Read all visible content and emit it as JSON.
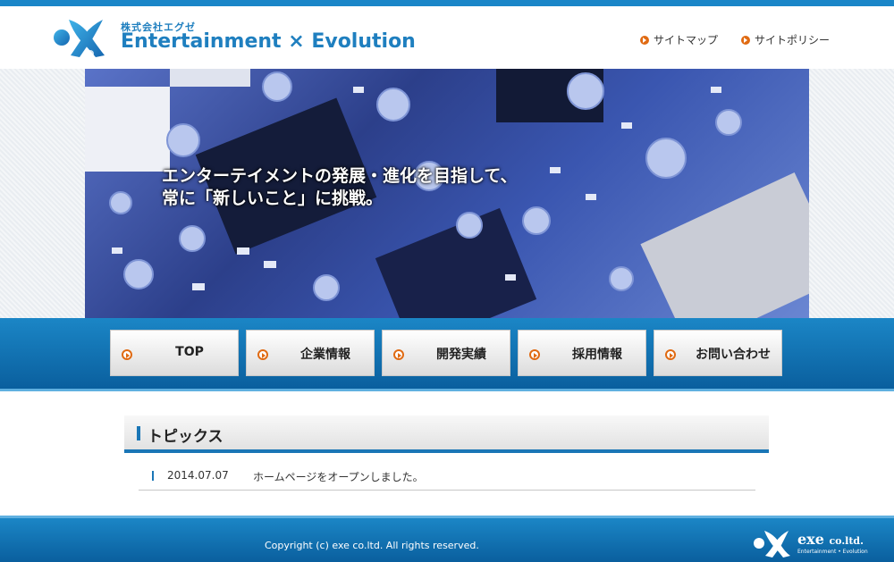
{
  "brand": {
    "company_ja": "株式会社エグゼ",
    "tagline": "Entertainment × Evolution",
    "accent": "#1f7fbf",
    "logo_icon": "exe-x-logo-icon"
  },
  "header_links": [
    {
      "label": "サイトマップ",
      "icon": "orange-arrow-icon"
    },
    {
      "label": "サイトポリシー",
      "icon": "orange-arrow-icon"
    }
  ],
  "hero": {
    "line1": "エンターテイメントの発展・進化を目指して、",
    "line2": "常に「新しいこと」に挑戦。",
    "image": "circuit-board-photo"
  },
  "nav": [
    {
      "label": "TOP"
    },
    {
      "label": "企業情報"
    },
    {
      "label": "開発実績"
    },
    {
      "label": "採用情報"
    },
    {
      "label": "お問い合わせ"
    }
  ],
  "topics": {
    "title": "トピックス",
    "items": [
      {
        "date": "2014.07.07",
        "text": "ホームページをオープンしました。"
      }
    ]
  },
  "footer": {
    "copyright": "Copyright (c) exe co.ltd. All rights reserved.",
    "brand_main": "exe",
    "brand_suffix": "co.ltd.",
    "brand_tag": "Entertainment • Evolution"
  },
  "colors": {
    "primary_blue": "#1a86c8",
    "orange": "#e06a12"
  }
}
